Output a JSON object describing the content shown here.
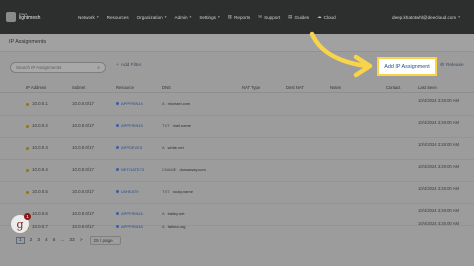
{
  "app": {
    "logo_small": "Cloud",
    "logo_main": "lightmesh"
  },
  "nav": {
    "items": [
      {
        "label": "Network",
        "has_caret": true,
        "icon": ""
      },
      {
        "label": "Resources",
        "has_caret": false,
        "icon": ""
      },
      {
        "label": "Organization",
        "has_caret": true,
        "icon": ""
      },
      {
        "label": "Admin",
        "has_caret": true,
        "icon": ""
      },
      {
        "label": "Settings",
        "has_caret": true,
        "icon": ""
      },
      {
        "label": "Reports",
        "has_caret": false,
        "icon": "chart-icon"
      },
      {
        "label": "Support",
        "has_caret": false,
        "icon": "support-icon"
      },
      {
        "label": "Guides",
        "has_caret": false,
        "icon": "book-icon"
      },
      {
        "label": "Cloud",
        "has_caret": false,
        "icon": "cloud-icon"
      }
    ],
    "user_email": "deep.khatotwhl@deecloud.com"
  },
  "page": {
    "title": "IP Assignments"
  },
  "toolbar": {
    "search_placeholder": "Search IP Assignments",
    "add_filter_label": "Add Filter",
    "add_ip_label": "Add IP Assignment",
    "release_label": "Release"
  },
  "table": {
    "columns": [
      "IP Address",
      "Subnet",
      "Resource",
      "DNS",
      "NAT Type",
      "Dest NAT",
      "Notes",
      "Contact",
      "Last Seen"
    ],
    "rows": [
      {
        "ip": "10.0.0.1",
        "subnet": "10.0.0.0/17",
        "resource": "APPFRIN14",
        "dns_type": "A",
        "dns_name": "michael.com",
        "last_seen": "10/4/2024 3:26:00 AM"
      },
      {
        "ip": "10.0.0.2",
        "subnet": "10.0.0.0/17",
        "resource": "APPFRIN15",
        "dns_type": "TXT",
        "dns_name": "mail.name",
        "last_seen": "10/4/2024 3:26:00 AM"
      },
      {
        "ip": "10.0.0.3",
        "subnet": "10.0.0.0/17",
        "resource": "APPDEVE3",
        "dns_type": "A",
        "dns_name": "white.net",
        "last_seen": "10/4/2024 3:26:00 AM"
      },
      {
        "ip": "10.0.0.4",
        "subnet": "10.0.0.0/17",
        "resource": "NETGATE73",
        "dns_type": "CNAME",
        "dns_name": "dunsaway.com",
        "last_seen": "10/4/2024 3:26:00 AM"
      },
      {
        "ip": "10.0.0.5",
        "subnet": "10.0.0.0/17",
        "resource": "LBHEAT9",
        "dns_type": "TXT",
        "dns_name": "rocky.name",
        "last_seen": "10/4/2024 3:26:00 AM"
      },
      {
        "ip": "10.0.0.6",
        "subnet": "10.0.0.0/17",
        "resource": "APPFRIN16",
        "dns_type": "A",
        "dns_name": "bailey.net",
        "last_seen": "10/4/2024 3:26:00 AM"
      },
      {
        "ip": "10.0.0.7",
        "subnet": "10.0.0.0/17",
        "resource": "APPFRIN18",
        "dns_type": "A",
        "dns_name": "fatima.org",
        "last_seen": "10/4/2024 3:26:00 AM"
      }
    ]
  },
  "pagination": {
    "pages": [
      "1",
      "2",
      "3",
      "4",
      "5",
      "...",
      "33",
      ">"
    ],
    "active": "1",
    "page_size": "25 / page"
  },
  "avatar": {
    "letter": "g",
    "badge": "1"
  },
  "colors": {
    "highlight": "#f7d44a",
    "accent_link": "#1d4f8e",
    "topbar": "#2d2f2f"
  }
}
